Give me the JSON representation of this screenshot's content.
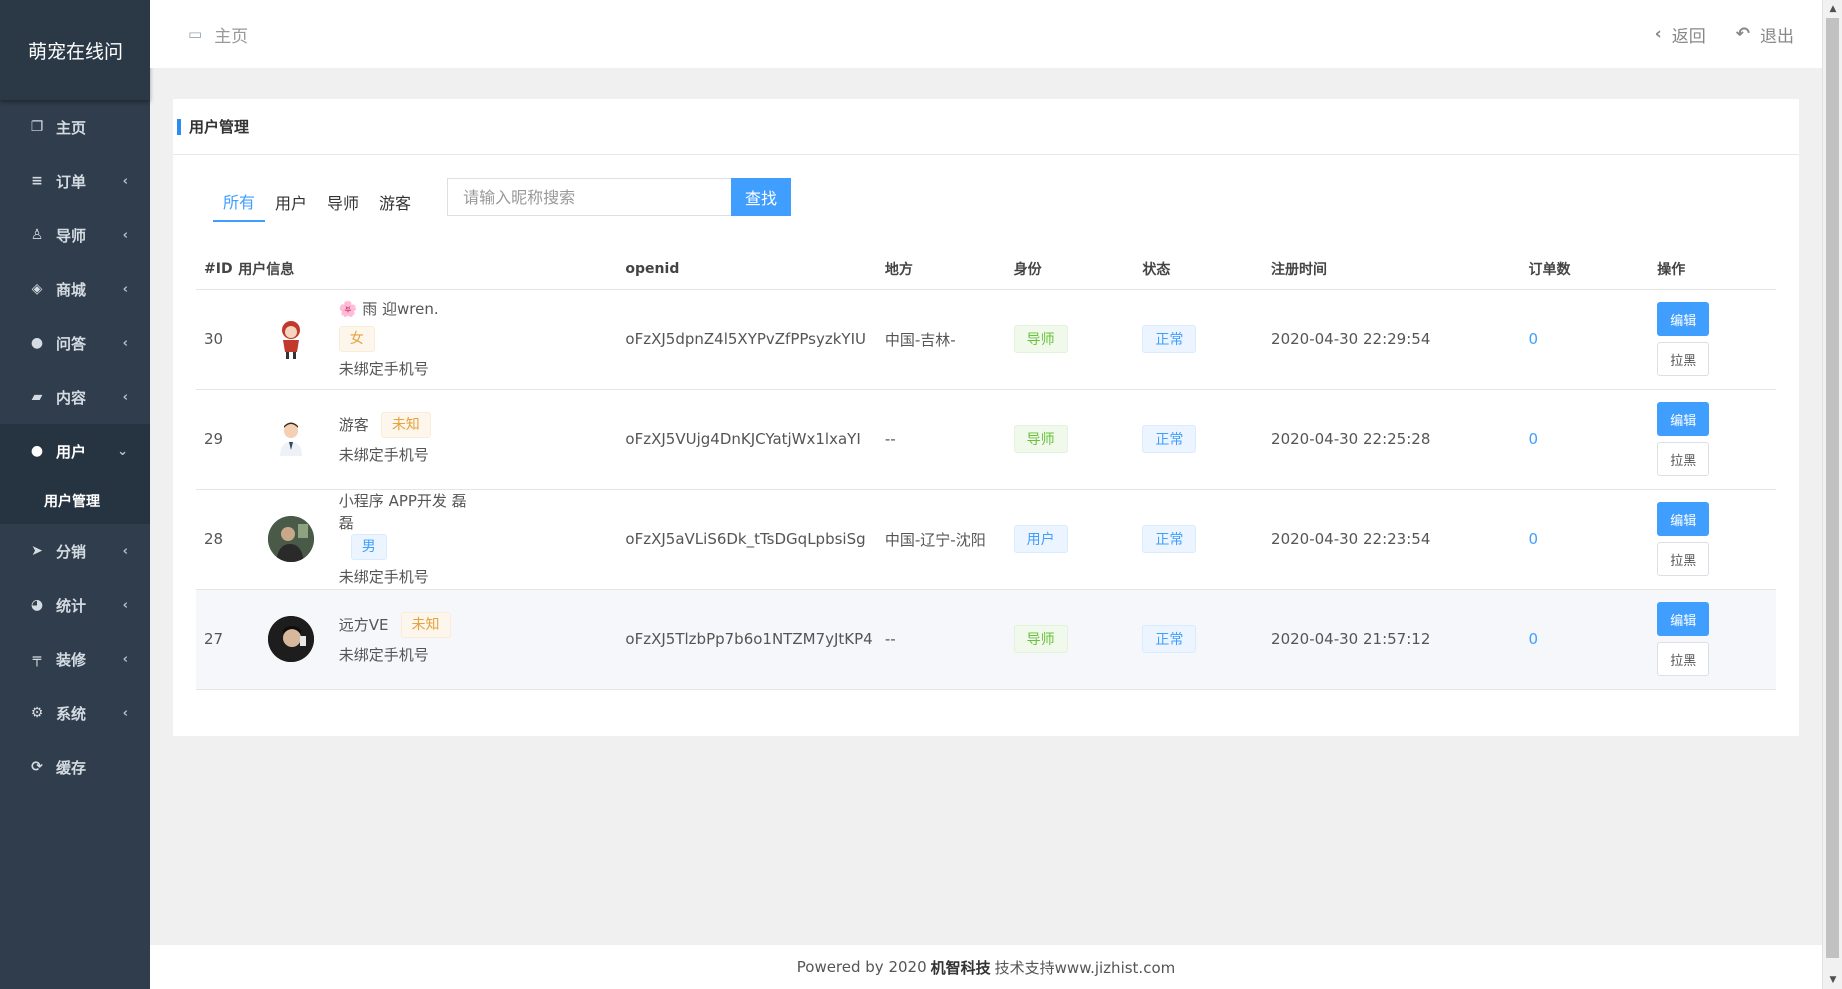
{
  "app": {
    "brand": "萌宠在线问"
  },
  "sidebar": {
    "items": [
      {
        "icon": "copy-icon",
        "label": "主页",
        "chevron": ""
      },
      {
        "icon": "list-icon",
        "label": "订单",
        "chevron": "‹"
      },
      {
        "icon": "person-icon",
        "label": "导师",
        "chevron": "‹"
      },
      {
        "icon": "tags-icon",
        "label": "商城",
        "chevron": "‹"
      },
      {
        "icon": "chat-icon",
        "label": "问答",
        "chevron": "‹"
      },
      {
        "icon": "book-icon",
        "label": "内容",
        "chevron": "‹"
      },
      {
        "icon": "user-icon",
        "label": "用户",
        "chevron": "⌄"
      },
      {
        "icon": "send-icon",
        "label": "分销",
        "chevron": "‹"
      },
      {
        "icon": "pie-icon",
        "label": "统计",
        "chevron": "‹"
      },
      {
        "icon": "sign-icon",
        "label": "装修",
        "chevron": "‹"
      },
      {
        "icon": "gear-icon",
        "label": "系统",
        "chevron": "‹"
      },
      {
        "icon": "refresh-icon",
        "label": "缓存",
        "chevron": ""
      }
    ],
    "subitem": "用户管理"
  },
  "topbar": {
    "crumb": "主页",
    "back": "返回",
    "logout": "退出"
  },
  "panel": {
    "title": "用户管理"
  },
  "filters": {
    "tabs": [
      "所有",
      "用户",
      "导师",
      "游客"
    ],
    "search_placeholder": "请输入昵称搜索",
    "search_button": "查找"
  },
  "table": {
    "headers": [
      "#ID",
      "用户信息",
      "openid",
      "地方",
      "身份",
      "状态",
      "注册时间",
      "订单数",
      "操作"
    ],
    "rows": [
      {
        "id": "30",
        "name": "🌸 雨 迎wren.",
        "gender": "女",
        "phone": "未绑定手机号",
        "openid": "oFzXJ5dpnZ4l5XYPvZfPPsyzkYIU",
        "location": "中国-吉林-",
        "role": "导师",
        "status": "正常",
        "time": "2020-04-30 22:29:54",
        "orders": "0"
      },
      {
        "id": "29",
        "name": "游客",
        "gender": "未知",
        "phone": "未绑定手机号",
        "openid": "oFzXJ5VUjg4DnKJCYatjWx1lxaYI",
        "location": "--",
        "role": "导师",
        "status": "正常",
        "time": "2020-04-30 22:25:28",
        "orders": "0"
      },
      {
        "id": "28",
        "name": "小程序 APP开发 磊磊",
        "gender": "男",
        "phone": "未绑定手机号",
        "openid": "oFzXJ5aVLiS6Dk_tTsDGqLpbsiSg",
        "location": "中国-辽宁-沈阳",
        "role": "用户",
        "status": "正常",
        "time": "2020-04-30 22:23:54",
        "orders": "0"
      },
      {
        "id": "27",
        "name": "远方VE",
        "gender": "未知",
        "phone": "未绑定手机号",
        "openid": "oFzXJ5TlzbPp7b6o1NTZM7yJtKP4",
        "location": "--",
        "role": "导师",
        "status": "正常",
        "time": "2020-04-30 21:57:12",
        "orders": "0"
      }
    ],
    "edit_label": "编辑",
    "block_label": "拉黑"
  },
  "footer": {
    "prefix": "Powered by 2020",
    "company": "机智科技",
    "suffix": "技术支持www.jizhist.com"
  },
  "colors": {
    "sidebar": "#2f3d4c",
    "accent": "#409eff",
    "success": "#67c23a",
    "warning": "#e6a23c"
  }
}
